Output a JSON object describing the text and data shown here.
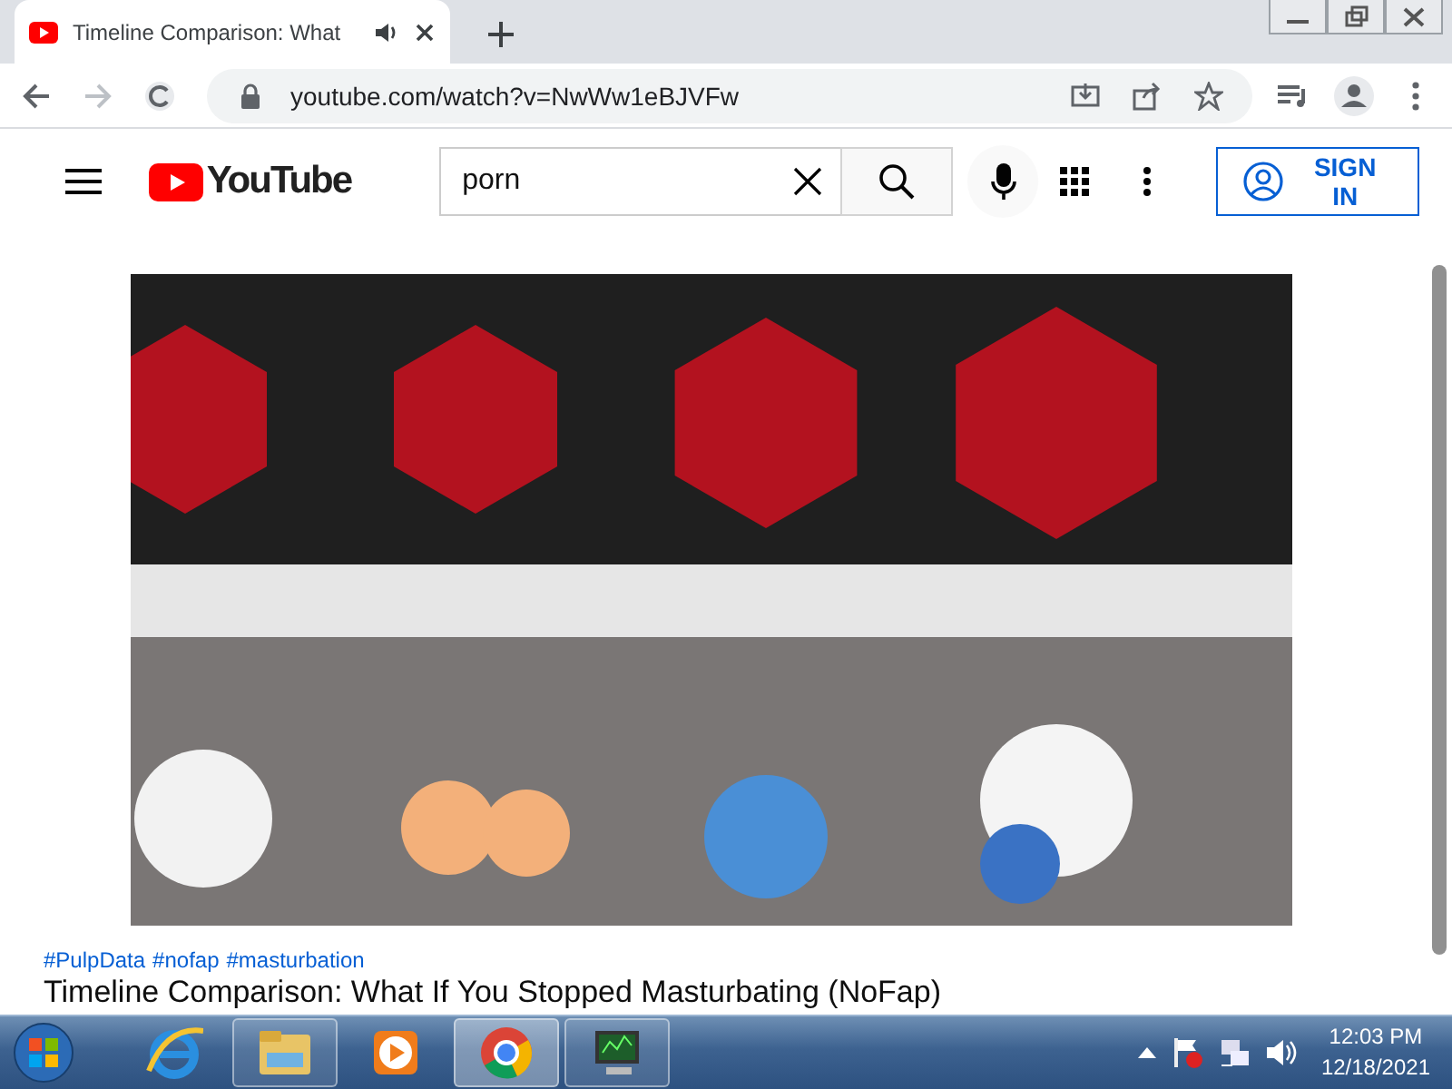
{
  "browser": {
    "tabs": [
      {
        "title": "Timeline Comparison: What",
        "selected": true,
        "audio": true
      }
    ],
    "address": "youtube.com/watch?v=NwWw1eBJVFw"
  },
  "youtube": {
    "logo": "YouTube",
    "search": {
      "value": "porn"
    },
    "sign_in": "SIGN IN"
  },
  "video": {
    "hashtags": [
      "#PulpData",
      "#nofap",
      "#masturbation"
    ],
    "title": "Timeline Comparison: What If You Stopped Masturbating (NoFap)"
  },
  "taskbar": {
    "apps": [
      {
        "kind": "ie",
        "running": false,
        "selected": false
      },
      {
        "kind": "explorer",
        "running": true,
        "selected": false
      },
      {
        "kind": "media",
        "running": false,
        "selected": false
      },
      {
        "kind": "chrome",
        "running": true,
        "selected": true
      },
      {
        "kind": "monitor",
        "running": true,
        "selected": false
      }
    ],
    "time": "12:03 PM",
    "date": "12/18/2021"
  }
}
